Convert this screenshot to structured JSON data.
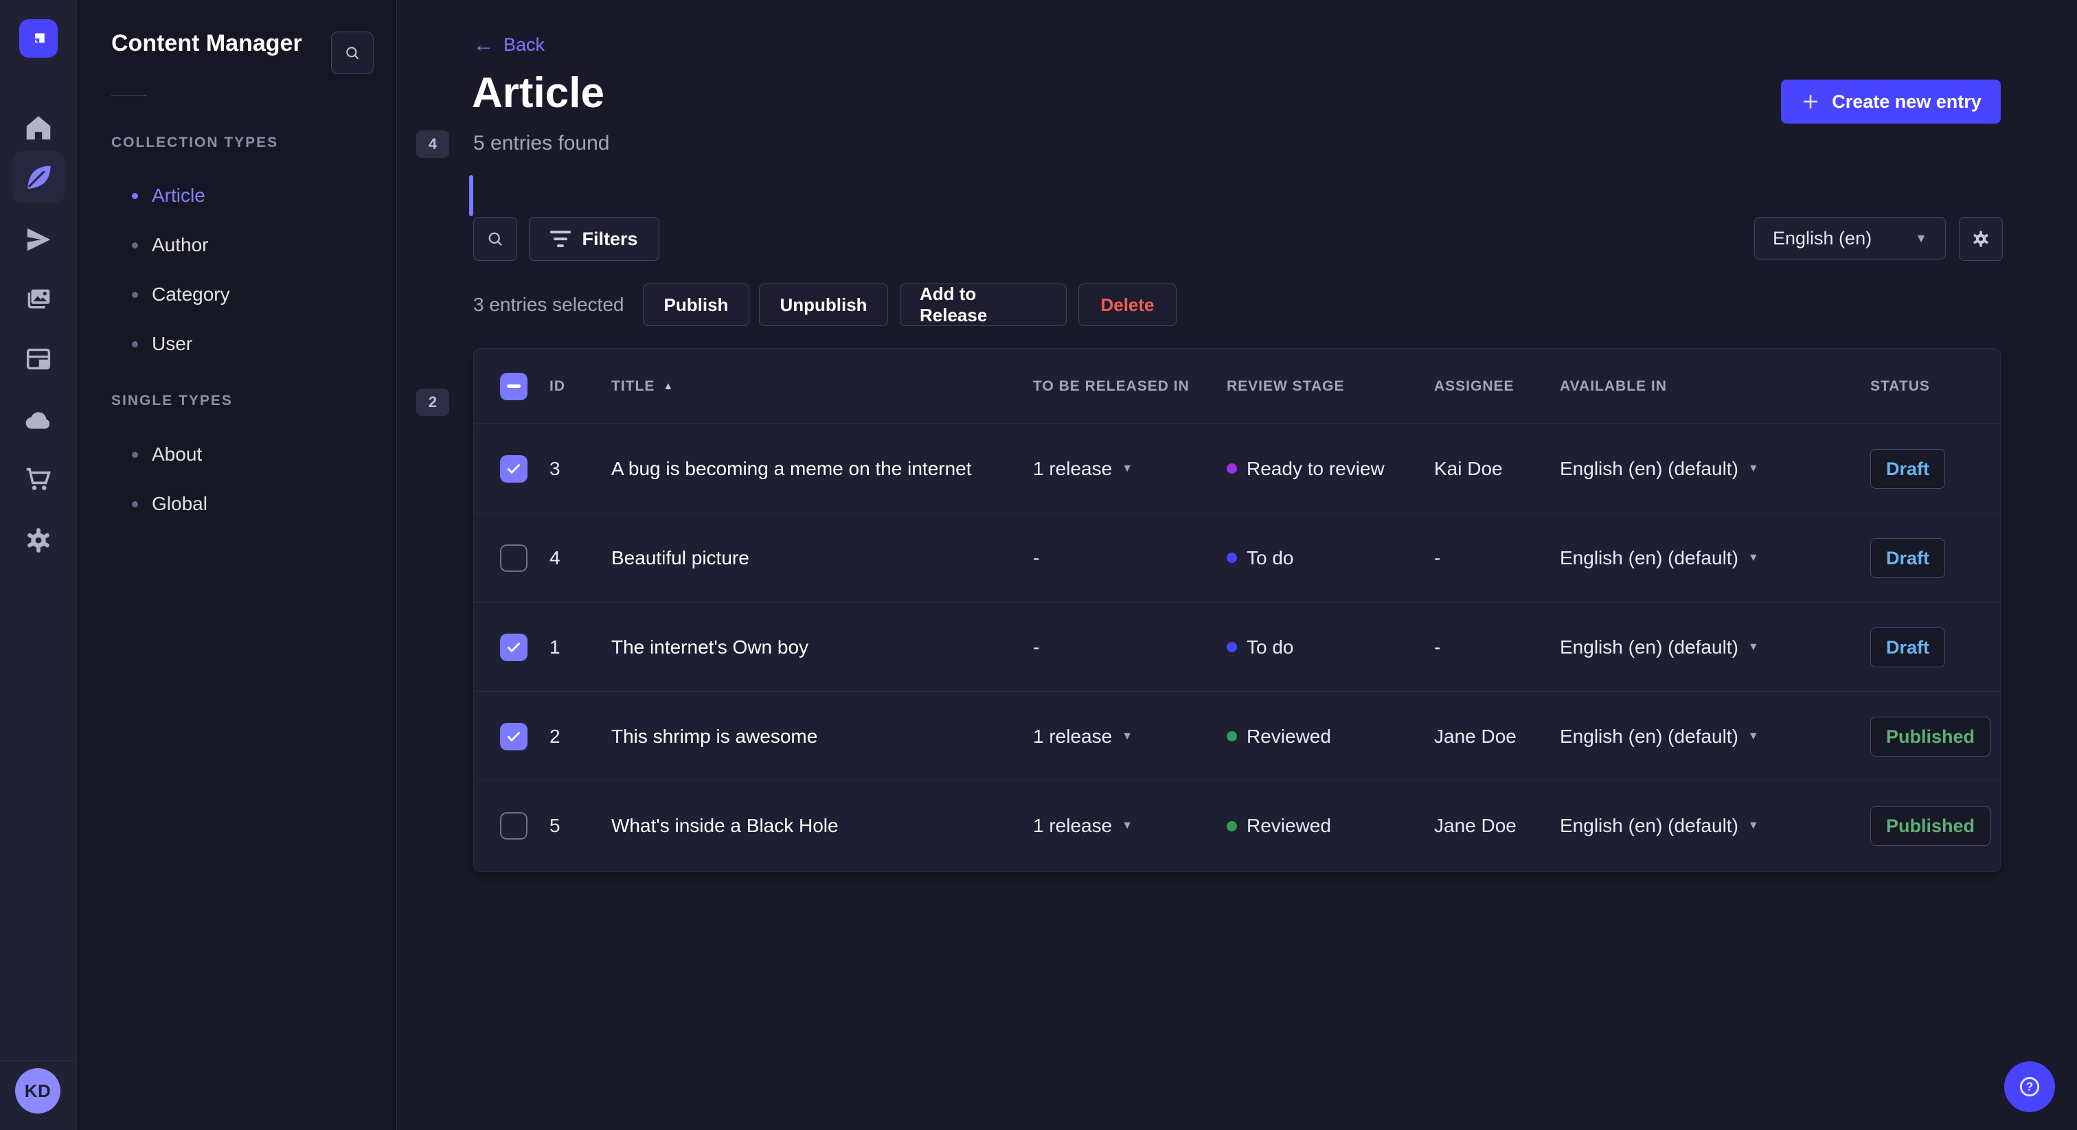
{
  "icons": {
    "caret_down": "▼",
    "sort_asc": "▲",
    "back_arrow": "←"
  },
  "colors": {
    "accent": "#4945ff",
    "link": "#7b79ff",
    "draft_text": "#66b7f1",
    "published_text": "#5cb176",
    "stage_ready": "#9736e8",
    "stage_todo": "#4945ff",
    "stage_reviewed": "#339960"
  },
  "rail": {
    "avatar_initials": "KD"
  },
  "subnav": {
    "title": "Content Manager",
    "sections": [
      {
        "label": "COLLECTION TYPES",
        "badge": "4",
        "items": [
          {
            "label": "Article",
            "active": "true"
          },
          {
            "label": "Author"
          },
          {
            "label": "Category"
          },
          {
            "label": "User"
          }
        ]
      },
      {
        "label": "SINGLE TYPES",
        "badge": "2",
        "items": [
          {
            "label": "About"
          },
          {
            "label": "Global"
          }
        ]
      }
    ]
  },
  "header": {
    "back_label": "Back",
    "title": "Article",
    "subtitle": "5 entries found",
    "create_button": "Create new entry"
  },
  "toolbar": {
    "filters_label": "Filters",
    "locale_value": "English (en)"
  },
  "selection": {
    "text": "3 entries selected",
    "publish": "Publish",
    "unpublish": "Unpublish",
    "add_to_release": "Add to Release",
    "delete": "Delete"
  },
  "table": {
    "header_checkbox": "indeterminate",
    "columns": {
      "id": "ID",
      "title": "TITLE",
      "released": "TO BE RELEASED IN",
      "review": "REVIEW STAGE",
      "assignee": "ASSIGNEE",
      "available": "AVAILABLE IN",
      "status": "STATUS"
    },
    "rows": [
      {
        "checked": "true",
        "id": "3",
        "title": "A bug is becoming a meme on the internet",
        "release": "1 release",
        "caret": "true",
        "stage": "Ready to review",
        "stage_kind": "ready",
        "assignee": "Kai Doe",
        "locale": "English (en) (default)",
        "status": "Draft",
        "status_kind": "draft"
      },
      {
        "checked": "false",
        "id": "4",
        "title": "Beautiful picture",
        "release": "-",
        "caret": "false",
        "stage": "To do",
        "stage_kind": "todo",
        "assignee": "-",
        "locale": "English (en) (default)",
        "status": "Draft",
        "status_kind": "draft"
      },
      {
        "checked": "true",
        "id": "1",
        "title": "The internet's Own boy",
        "release": "-",
        "caret": "false",
        "stage": "To do",
        "stage_kind": "todo",
        "assignee": "-",
        "locale": "English (en) (default)",
        "status": "Draft",
        "status_kind": "draft"
      },
      {
        "checked": "true",
        "id": "2",
        "title": "This shrimp is awesome",
        "release": "1 release",
        "caret": "true",
        "stage": "Reviewed",
        "stage_kind": "reviewed",
        "assignee": "Jane Doe",
        "locale": "English (en) (default)",
        "status": "Published",
        "status_kind": "published"
      },
      {
        "checked": "false",
        "id": "5",
        "title": "What's inside a Black Hole",
        "release": "1 release",
        "caret": "true",
        "stage": "Reviewed",
        "stage_kind": "reviewed",
        "assignee": "Jane Doe",
        "locale": "English (en) (default)",
        "status": "Published",
        "status_kind": "published"
      }
    ]
  }
}
